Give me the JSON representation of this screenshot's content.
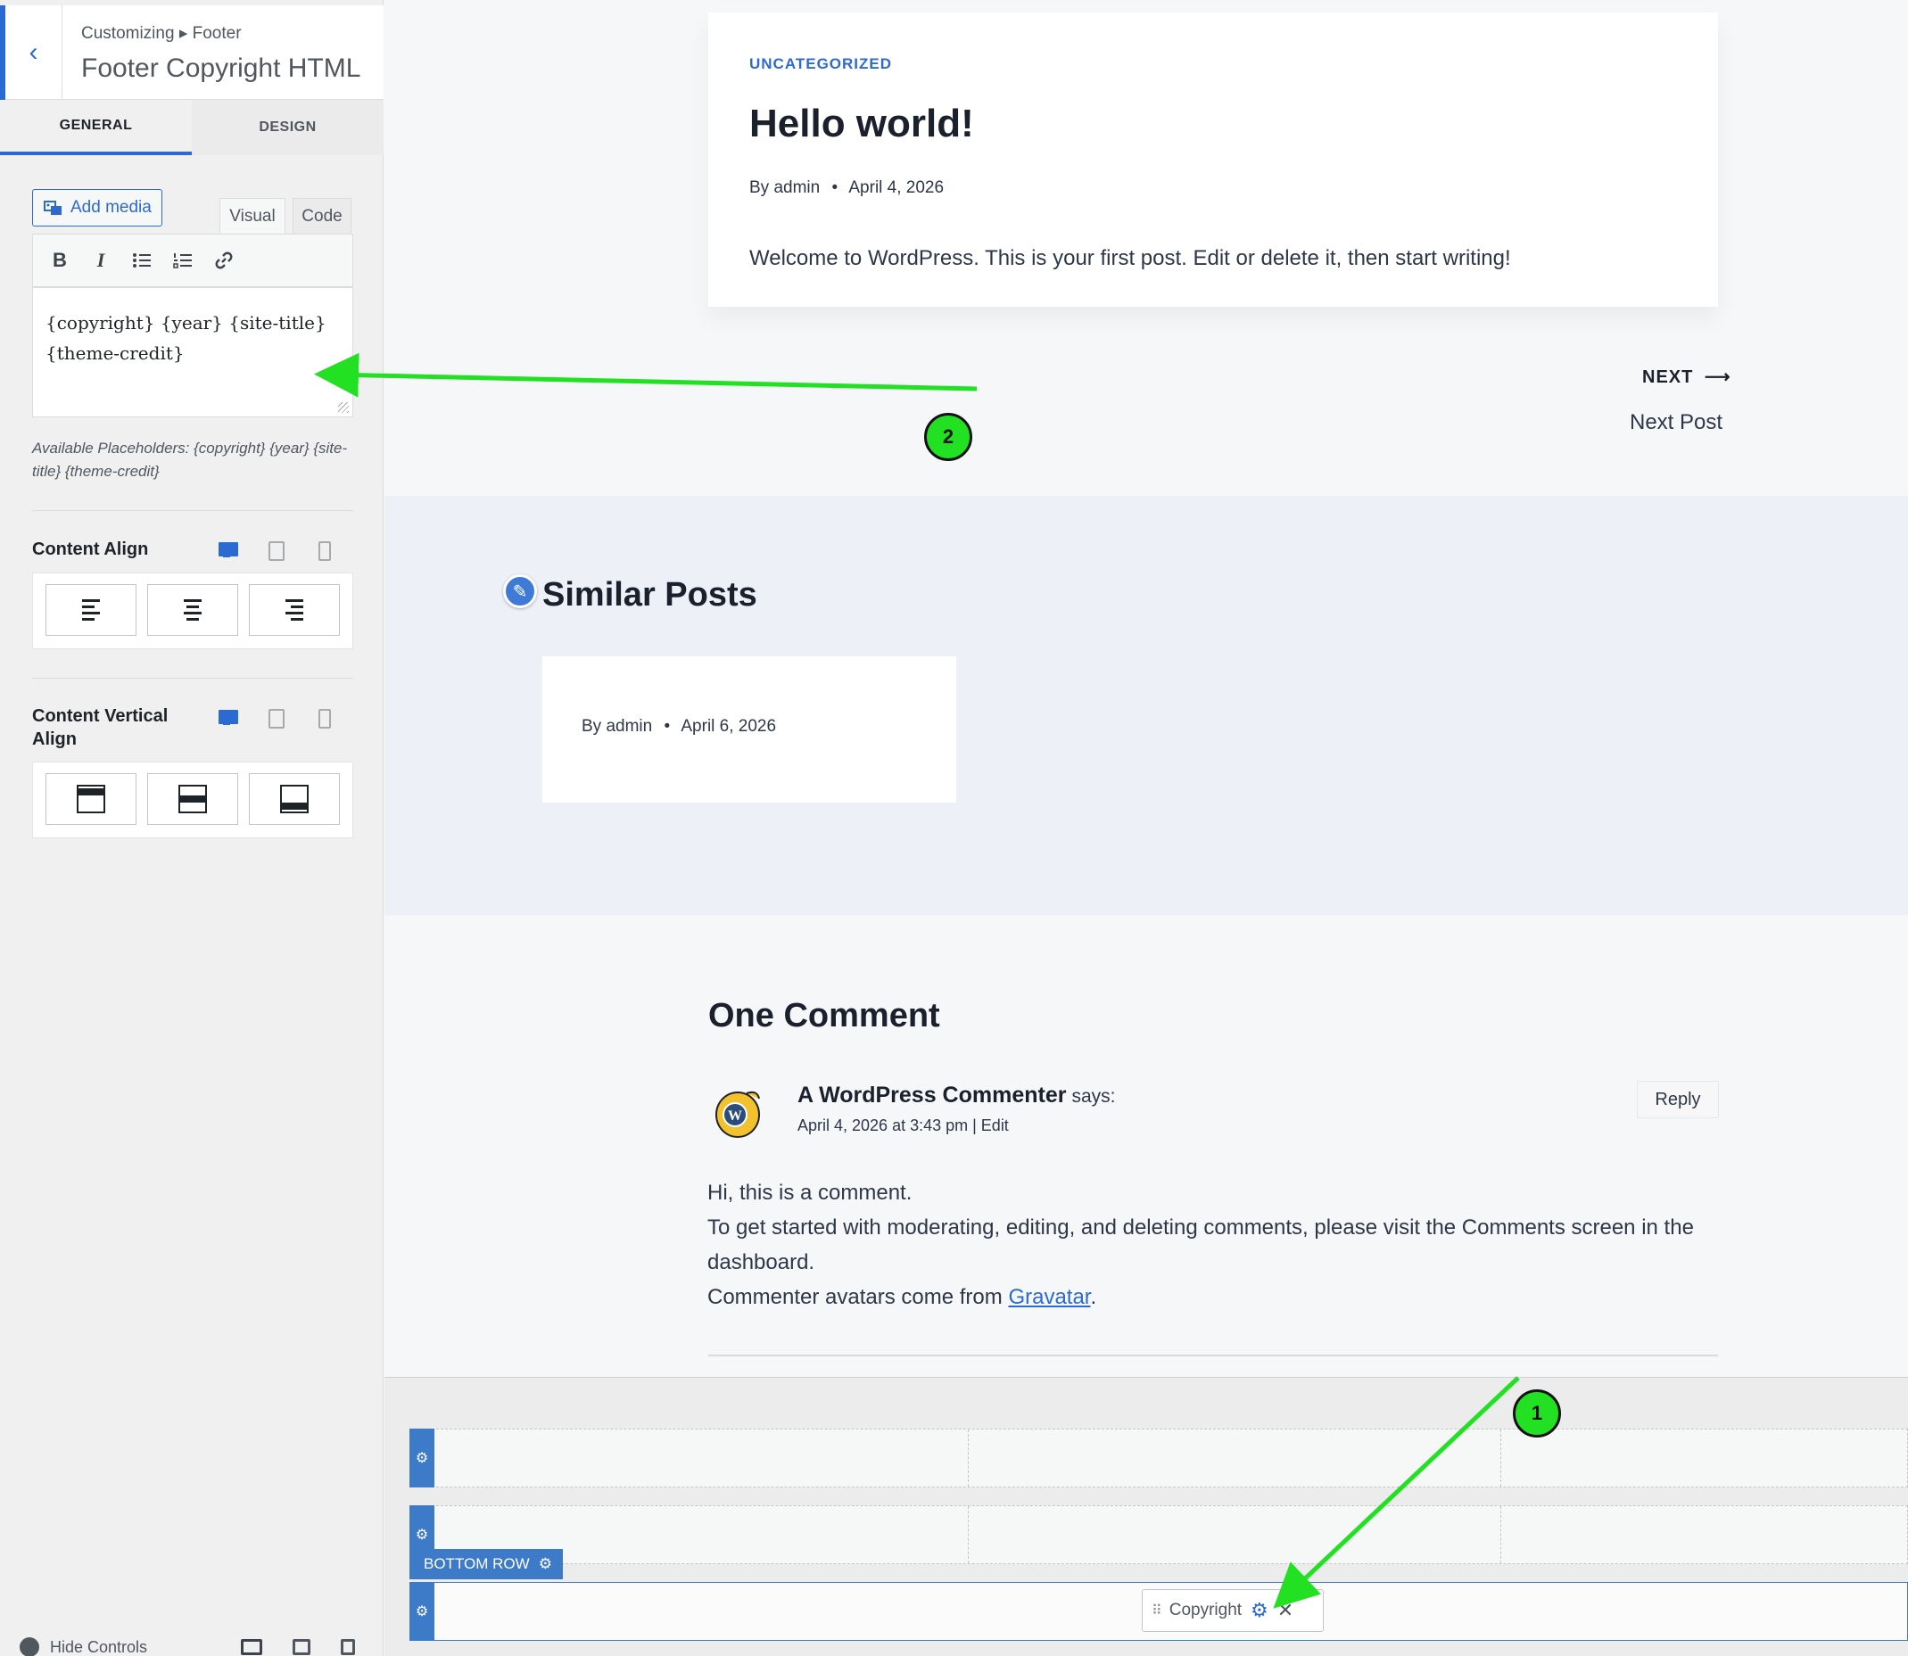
{
  "sidebar": {
    "back_icon": "chevron-left-icon",
    "breadcrumb": "Customizing ▸ Footer",
    "title": "Footer Copyright HTML",
    "tabs": [
      {
        "label": "GENERAL",
        "active": true
      },
      {
        "label": "DESIGN",
        "active": false
      }
    ],
    "editor": {
      "add_media_label": "Add media",
      "tab_visual": "Visual",
      "tab_code": "Code",
      "toolbar": [
        {
          "icon": "bold-icon",
          "glyph": "B"
        },
        {
          "icon": "italic-icon",
          "glyph": "I"
        },
        {
          "icon": "bullet-list-icon",
          "glyph": "☰"
        },
        {
          "icon": "numbered-list-icon",
          "glyph": "☷"
        },
        {
          "icon": "link-icon",
          "glyph": "🔗"
        }
      ],
      "content_line1": "{copyright} {year} {site-title}",
      "content_line2": "{theme-credit}",
      "placeholder_note": "Available Placeholders: {copyright} {year} {site-title} {theme-credit}"
    },
    "content_align": {
      "label": "Content Align",
      "options": [
        "align-left",
        "align-center",
        "align-right"
      ]
    },
    "content_vertical_align": {
      "label": "Content Vertical Align",
      "options": [
        "align-top",
        "align-middle",
        "align-bottom"
      ]
    },
    "hide_controls_label": "Hide Controls"
  },
  "preview": {
    "post": {
      "category": "UNCATEGORIZED",
      "title": "Hello world!",
      "author": "By admin",
      "date": "April 4, 2026",
      "excerpt": "Welcome to WordPress. This is your first post. Edit or delete it, then start writing!"
    },
    "next": {
      "label": "NEXT",
      "arrow": "⟶",
      "title": "Next Post"
    },
    "similar": {
      "title": "Similar Posts",
      "card_author": "By admin",
      "card_date": "April 6, 2026"
    },
    "comments": {
      "title": "One Comment",
      "commenter": "A WordPress Commenter",
      "says": "says:",
      "date": "April 4, 2026 at 3:43 pm | Edit",
      "reply": "Reply",
      "body_line1": "Hi, this is a comment.",
      "body_line2": "To get started with moderating, editing, and deleting comments, please visit the Comments screen in the dashboard.",
      "body_line3_prefix": "Commenter avatars come from ",
      "body_link": "Gravatar",
      "body_line3_suffix": "."
    },
    "builder": {
      "bottom_row_label": "BOTTOM ROW",
      "copyright_chip": "Copyright"
    }
  },
  "annotations": [
    {
      "label": "1",
      "color": "#22e022"
    },
    {
      "label": "2",
      "color": "#22e022"
    }
  ],
  "colors": {
    "accent": "#2c6ad3",
    "builder_blue": "#3d7bc8",
    "annotation_green": "#22e022"
  }
}
